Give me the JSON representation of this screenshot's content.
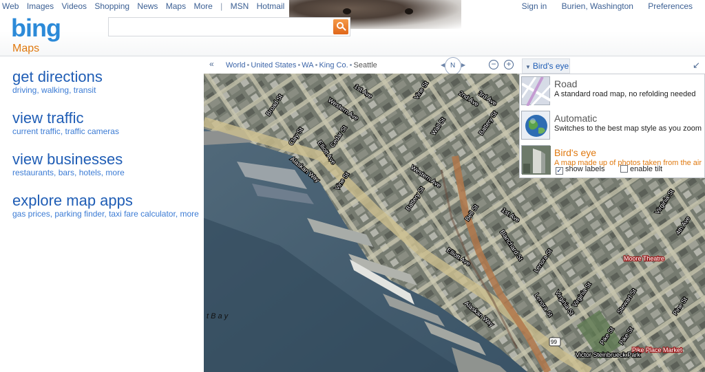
{
  "topnav": {
    "left": [
      "Web",
      "Images",
      "Videos",
      "Shopping",
      "News",
      "Maps",
      "More",
      "|",
      "MSN",
      "Hotmail"
    ],
    "sign_in": "Sign in",
    "location": "Burien, Washington",
    "preferences": "Preferences"
  },
  "brand": {
    "logo": "bing",
    "section": "Maps",
    "logo_color": "#2c8ad8",
    "section_color": "#e0790f"
  },
  "search": {
    "value": "",
    "button_icon": "search-icon"
  },
  "tasks": [
    {
      "title": "get directions",
      "links": [
        "driving",
        "walking",
        "transit"
      ]
    },
    {
      "title": "view traffic",
      "links": [
        "current traffic",
        "traffic cameras"
      ]
    },
    {
      "title": "view businesses",
      "links": [
        "restaurants",
        "bars",
        "hotels",
        "more"
      ]
    },
    {
      "title": "explore map apps",
      "links": [
        "gas prices",
        "parking finder",
        "taxi fare calculator",
        "more"
      ]
    }
  ],
  "toolbar": {
    "collapse": "«",
    "breadcrumb": [
      "World",
      "United States",
      "WA",
      "King Co.",
      "Seattle"
    ],
    "compass": "N",
    "zoom_out": "−",
    "zoom_in": "+",
    "map_style": "Bird's eye",
    "expand_icon": "↙"
  },
  "style_panel": {
    "options": [
      {
        "name": "Road",
        "desc": "A standard road map, no refolding needed",
        "icon": "road-map-icon"
      },
      {
        "name": "Automatic",
        "desc": "Switches to the best map style as you zoom",
        "icon": "globe-icon"
      },
      {
        "name": "Bird's eye",
        "desc": "A map made up of photos taken from the air",
        "icon": "birds-eye-icon"
      }
    ],
    "show_labels": "show labels",
    "show_labels_checked": true,
    "enable_tilt": "enable tilt",
    "enable_tilt_checked": false
  },
  "map": {
    "street_labels": [
      "Broad St",
      "Western Ave",
      "1st Ave",
      "Vine St",
      "2nd Ave",
      "3rd Ave",
      "Wall St",
      "Battery St",
      "Clay St",
      "Elliott Ave",
      "Cedar St",
      "Alaskan Way",
      "Vine St",
      "Western Ave",
      "Battery St",
      "Bell St",
      "1st Ave",
      "Blanchard St",
      "Elliott Ave",
      "Lenora St",
      "Virginia St",
      "4th Ave",
      "Virginia St",
      "Alaskan Way",
      "Stewart St",
      "Pine St",
      "Pike St",
      "Pike St",
      "Lenora St",
      "Virginia St"
    ],
    "place_labels": [
      "Moore Theatre",
      "Pike Place Market",
      "Victor Steinbrueck Park"
    ],
    "water_label": "t B a y",
    "route_shield": "99"
  }
}
